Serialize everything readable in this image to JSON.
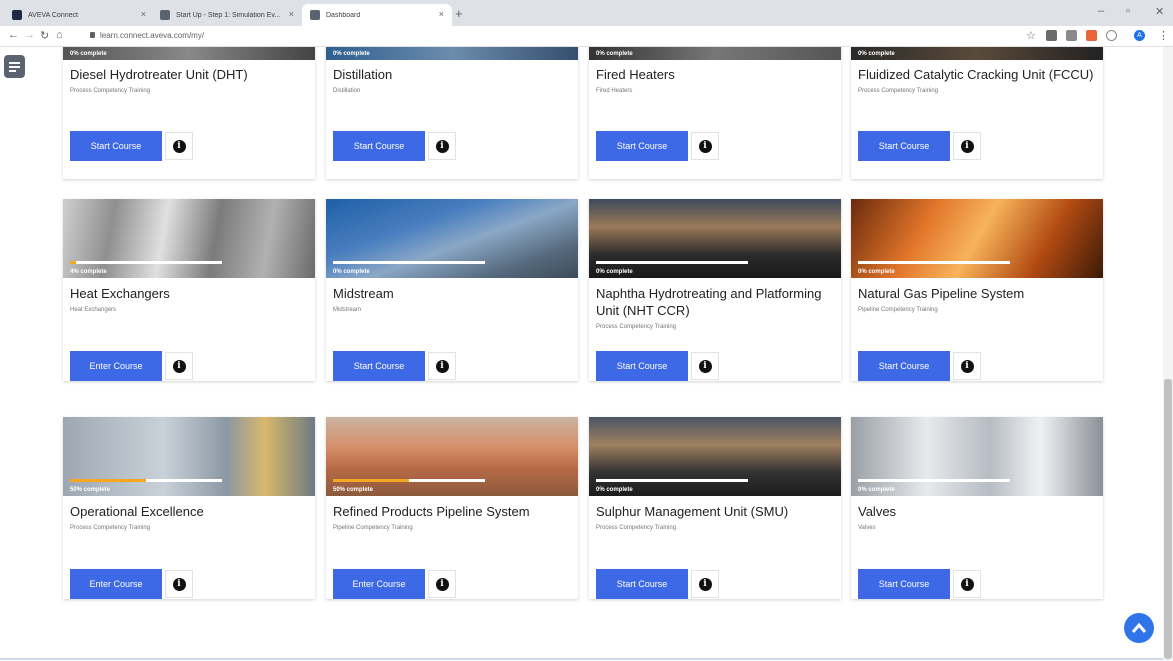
{
  "browser": {
    "tabs": [
      {
        "title": "AVEVA Connect",
        "favicon_color": "#1f2a44"
      },
      {
        "title": "Start Up - Step 1: Simulation Ev...",
        "favicon_color": "#5a6470"
      },
      {
        "title": "Dashboard",
        "favicon_color": "#5a6470"
      }
    ],
    "new_tab_symbol": "+",
    "close_symbol": "×",
    "url": "learn.connect.aveva.com/my/",
    "profile_initial": "A"
  },
  "theme": {
    "accent": "#3d68e6",
    "progress": "#f5a623"
  },
  "page": {
    "menu_icon": "menu-icon",
    "scroll_top_icon": "chevron-up-icon"
  },
  "courses": [
    {
      "title": "Diesel Hydrotreater Unit (DHT)",
      "subtitle": "Process Competency Training",
      "progress_label": "0% complete",
      "progress": 0,
      "button": "Start Course"
    },
    {
      "title": "Distillation",
      "subtitle": "Distillation",
      "progress_label": "0% complete",
      "progress": 0,
      "button": "Start Course"
    },
    {
      "title": "Fired Heaters",
      "subtitle": "Fired Heaters",
      "progress_label": "0% complete",
      "progress": 0,
      "button": "Start Course"
    },
    {
      "title": "Fluidized Catalytic Cracking Unit (FCCU)",
      "subtitle": "Process Competency Training",
      "progress_label": "0% complete",
      "progress": 0,
      "button": "Start Course"
    },
    {
      "title": "Heat Exchangers",
      "subtitle": "Heat Exchangers",
      "progress_label": "4% complete",
      "progress": 4,
      "button": "Enter Course"
    },
    {
      "title": "Midstream",
      "subtitle": "Midstream",
      "progress_label": "0% complete",
      "progress": 0,
      "button": "Start Course"
    },
    {
      "title": "Naphtha Hydrotreating and Platforming Unit (NHT CCR)",
      "subtitle": "Process Competency Training",
      "progress_label": "0% complete",
      "progress": 0,
      "button": "Start Course"
    },
    {
      "title": "Natural Gas Pipeline System",
      "subtitle": "Pipeline Competency Training",
      "progress_label": "0% complete",
      "progress": 0,
      "button": "Start Course"
    },
    {
      "title": "Operational Excellence",
      "subtitle": "Process Competency Training",
      "progress_label": "50% complete",
      "progress": 50,
      "button": "Enter Course"
    },
    {
      "title": "Refined Products Pipeline System",
      "subtitle": "Pipeline Competency Training",
      "progress_label": "50% complete",
      "progress": 50,
      "button": "Enter Course"
    },
    {
      "title": "Sulphur Management Unit (SMU)",
      "subtitle": "Process Competency Training",
      "progress_label": "0% complete",
      "progress": 0,
      "button": "Start Course"
    },
    {
      "title": "Valves",
      "subtitle": "Valves",
      "progress_label": "0% complete",
      "progress": 0,
      "button": "Start Course"
    }
  ]
}
